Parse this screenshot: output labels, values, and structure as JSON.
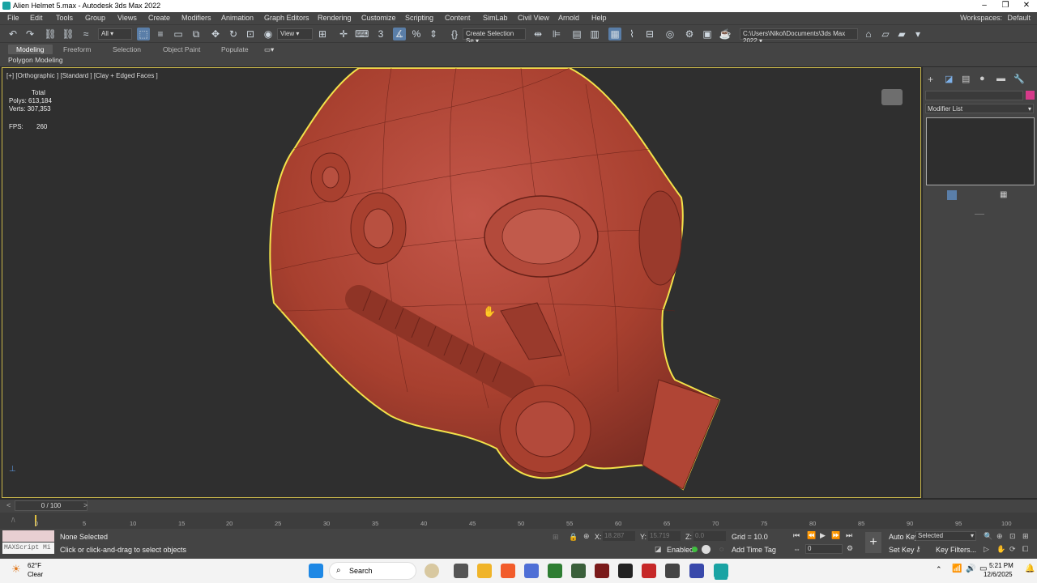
{
  "window": {
    "title": "Alien Helmet 5.max - Autodesk 3ds Max 2022"
  },
  "menu": [
    "File",
    "Edit",
    "Tools",
    "Group",
    "Views",
    "Create",
    "Modifiers",
    "Animation",
    "Graph Editors",
    "Rendering",
    "Customize",
    "Scripting",
    "Content",
    "SimLab",
    "Civil View",
    "Arnold",
    "Help"
  ],
  "workspace": {
    "label": "Workspaces:",
    "value": "Default"
  },
  "toolbar": {
    "filter_value": "All",
    "refcoord_value": "View",
    "selection_set_placeholder": "Create Selection Se",
    "project_path": "C:\\Users\\Nikol\\Documents\\3ds Max 2022"
  },
  "ribbon": {
    "tabs": [
      "Modeling",
      "Freeform",
      "Selection",
      "Object Paint",
      "Populate"
    ],
    "active_tab": "Modeling",
    "subpanel": "Polygon Modeling"
  },
  "viewport": {
    "label": "[+] [Orthographic ] [Standard ] [Clay + Edged Faces ]",
    "stats": {
      "header": "Total",
      "polys_label": "Polys:",
      "polys": "613,184",
      "verts_label": "Verts:",
      "verts": "307,353",
      "fps_label": "FPS:",
      "fps": "260"
    }
  },
  "command_panel": {
    "modifier_list": "Modifier List",
    "color_swatch": "#d63a8a"
  },
  "timeline": {
    "position": "0 / 100",
    "ticks": [
      "0",
      "5",
      "10",
      "15",
      "20",
      "25",
      "30",
      "35",
      "40",
      "45",
      "50",
      "55",
      "60",
      "65",
      "70",
      "75",
      "80",
      "85",
      "90",
      "95",
      "100"
    ]
  },
  "status": {
    "maxscript": "MAXScript Mi",
    "selection": "None Selected",
    "prompt": "Click or click-and-drag to select objects",
    "x_label": "X:",
    "x": "18.287",
    "y_label": "Y:",
    "y": "15.719",
    "z_label": "Z:",
    "z": "0.0",
    "grid": "Grid = 10.0",
    "enabled": "Enabled:",
    "add_time_tag": "Add Time Tag",
    "auto_key": "Auto Key",
    "set_key": "Set Key",
    "key_mode": "Selected",
    "key_filters": "Key Filters...",
    "frame": "0"
  },
  "taskbar": {
    "weather_temp": "62°F",
    "weather_cond": "Clear",
    "search": "Search",
    "time": "5:21 PM",
    "date": "12/6/2025"
  }
}
